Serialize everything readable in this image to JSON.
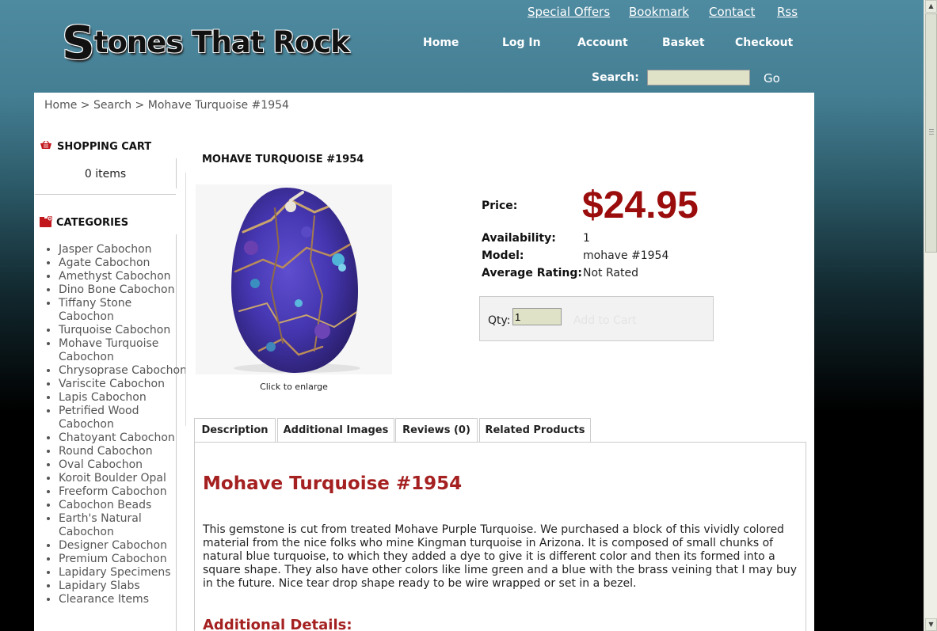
{
  "header": {
    "logo_text_cap": "S",
    "logo_text_rest": "tones That Rock",
    "top_links": [
      "Special Offers",
      "Bookmark",
      "Contact",
      "Rss"
    ],
    "nav": [
      "Home",
      "Log In",
      "Account",
      "Basket",
      "Checkout"
    ],
    "search_label": "Search:",
    "search_value": "",
    "search_button": "Go"
  },
  "breadcrumb": {
    "home": "Home",
    "search": "Search",
    "current": "Mohave Turquoise #1954",
    "separator": ">"
  },
  "sidebar": {
    "cart_title": "SHOPPING CART",
    "cart_count": "0 items",
    "categories_title": "CATEGORIES",
    "categories": [
      "Jasper Cabochon",
      "Agate Cabochon",
      "Amethyst Cabochon",
      "Dino Bone Cabochon",
      "Tiffany Stone Cabochon",
      "Turquoise Cabochon",
      "Mohave Turquoise Cabochon",
      "Chrysoprase Cabochon",
      "Variscite Cabochon",
      "Lapis Cabochon",
      "Petrified Wood Cabochon",
      "Chatoyant Cabochon",
      "Round Cabochon",
      "Oval Cabochon",
      "Koroit Boulder Opal",
      "Freeform Cabochon",
      "Cabochon Beads",
      "Earth's Natural Cabochon",
      "Designer Cabochon",
      "Premium Cabochon",
      "Lapidary Specimens",
      "Lapidary Slabs",
      "Clearance Items"
    ]
  },
  "product": {
    "title": "MOHAVE TURQUOISE #1954",
    "click_enlarge": "Click to enlarge",
    "price_label": "Price:",
    "price": "$24.95",
    "availability_label": "Availability:",
    "availability": "1",
    "model_label": "Model:",
    "model": "mohave #1954",
    "rating_label": "Average Rating:",
    "rating": "Not Rated",
    "qty_label": "Qty:",
    "qty_value": "1",
    "add_to_cart": "Add to Cart"
  },
  "tabs": [
    "Description",
    "Additional Images",
    "Reviews (0)",
    "Related Products"
  ],
  "description": {
    "heading": "Mohave Turquoise #1954",
    "text": "This gemstone is cut from treated Mohave Purple Turquoise. We purchased a block of this vividly colored material from the nice folks who mine Kingman turquoise in Arizona. It is composed of small chunks of natural blue turquoise, to which they added a dye to give it is different color and then its formed into a square shape. They also have other colors like lime green and a blue with the brass veining that I may buy in the future. Nice tear drop shape ready to be wire wrapped or set in a bezel.",
    "additional_heading": "Additional Details:"
  },
  "colors": {
    "price": "#9b0c0c",
    "heading": "#a52020",
    "input_bg": "#dfe2c6"
  }
}
